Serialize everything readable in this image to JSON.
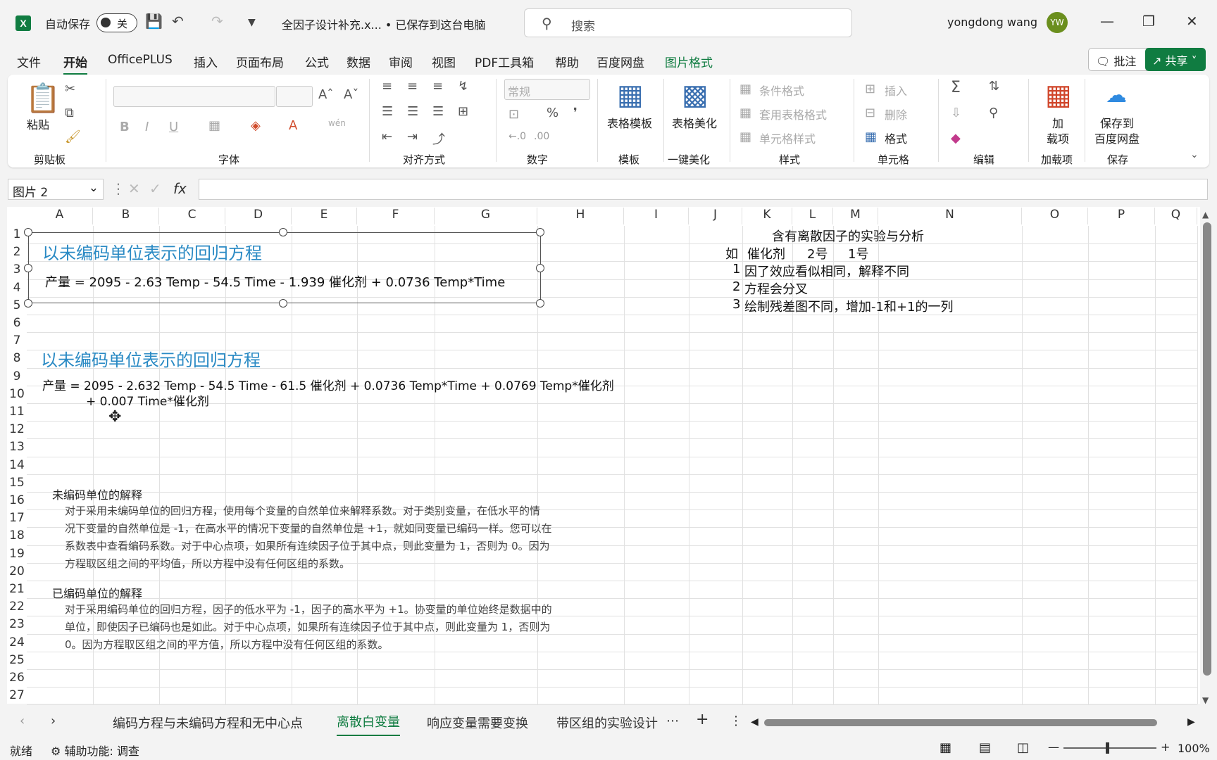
{
  "window": {
    "autosave_label": "自动保存",
    "autosave_state": "关",
    "filename": "全因子设计补充.x... • 已保存到这台电脑",
    "search_placeholder": "搜索",
    "user_name": "yongdong wang",
    "user_initials": "YW"
  },
  "menu": {
    "items": [
      "文件",
      "开始",
      "OfficePLUS",
      "插入",
      "页面布局",
      "公式",
      "数据",
      "审阅",
      "视图",
      "PDF工具箱",
      "帮助",
      "百度网盘",
      "图片格式"
    ],
    "comment": "批注",
    "share": "共享"
  },
  "ribbon": {
    "groups": {
      "clipboard": "剪贴板",
      "font": "字体",
      "align": "对齐方式",
      "number": "数字",
      "template": "模板",
      "beautify": "一键美化",
      "style": "样式",
      "cells": "单元格",
      "edit": "编辑",
      "addins": "加载项",
      "save": "保存"
    },
    "paste": "粘贴",
    "number_format": "常规",
    "table_template": "表格模板",
    "table_beautify": "表格美化",
    "cond_format": "条件格式",
    "table_format": "套用表格格式",
    "cell_style": "单元格样式",
    "insert": "插入",
    "delete": "删除",
    "format": "格式",
    "addin_l1": "加",
    "addin_l2": "载项",
    "save_l1": "保存到",
    "save_l2": "百度网盘"
  },
  "namebox": "图片 2",
  "columns": [
    "A",
    "B",
    "C",
    "D",
    "E",
    "F",
    "G",
    "H",
    "I",
    "J",
    "K",
    "L",
    "M",
    "N",
    "O",
    "P",
    "Q"
  ],
  "rows": [
    "1",
    "2",
    "3",
    "4",
    "5",
    "6",
    "7",
    "8",
    "9",
    "10",
    "11",
    "12",
    "13",
    "14",
    "15",
    "16",
    "17",
    "18",
    "19",
    "20",
    "21",
    "22",
    "23",
    "24",
    "25",
    "26",
    "27"
  ],
  "cells": {
    "r1": "含有离散因子的实验与分析",
    "r2_j": "如",
    "r2_k": "催化剂",
    "r2_l": "2号",
    "r2_m": "1号",
    "r3_j": "1",
    "r3_k": "因了效应看似相同，解释不同",
    "r4_j": "2",
    "r4_k": "方程会分叉",
    "r5_j": "3",
    "r5_k": "绘制残差图不同，增加-1和+1的一列"
  },
  "eq1": {
    "title": "以未编码单位表示的回归方程",
    "text": "产量 = 2095 - 2.63 Temp - 54.5 Time - 1.939 催化剂 + 0.0736 Temp*Time"
  },
  "eq2": {
    "title": "以未编码单位表示的回归方程",
    "line1": "产量 = 2095 - 2.632 Temp - 54.5 Time - 61.5 催化剂 + 0.0736 Temp*Time + 0.0769 Temp*催化剂",
    "line2": "+ 0.007 Time*催化剂"
  },
  "note1": {
    "title": "未编码单位的解释",
    "lines": [
      "对于采用未编码单位的回归方程，使用每个变量的自然单位来解释系数。对于类别变量，在低水平的情",
      "况下变量的自然单位是 -1，在高水平的情况下变量的自然单位是 +1，就如同变量已编码一样。您可以在",
      "系数表中查看编码系数。对于中心点项，如果所有连续因子位于其中点，则此变量为 1，否则为 0。因为",
      "方程取区组之间的平均值，所以方程中没有任何区组的系数。"
    ]
  },
  "note2": {
    "title": "已编码单位的解释",
    "lines": [
      "对于采用编码单位的回归方程，因子的低水平为 -1，因子的高水平为 +1。协变量的单位始终是数据中的",
      "单位，即使因子已编码也是如此。对于中心点项，如果所有连续因子位于其中点，则此变量为 1，否则为",
      "0。因为方程取区组之间的平方值，所以方程中没有任何区组的系数。"
    ]
  },
  "tabs": [
    "编码方程与未编码方程和无中心点",
    "离散白变量",
    "响应变量需要变换",
    "带区组的实验设计"
  ],
  "status": {
    "ready": "就绪",
    "accessibility": "辅助功能: 调查",
    "zoom": "100%"
  }
}
